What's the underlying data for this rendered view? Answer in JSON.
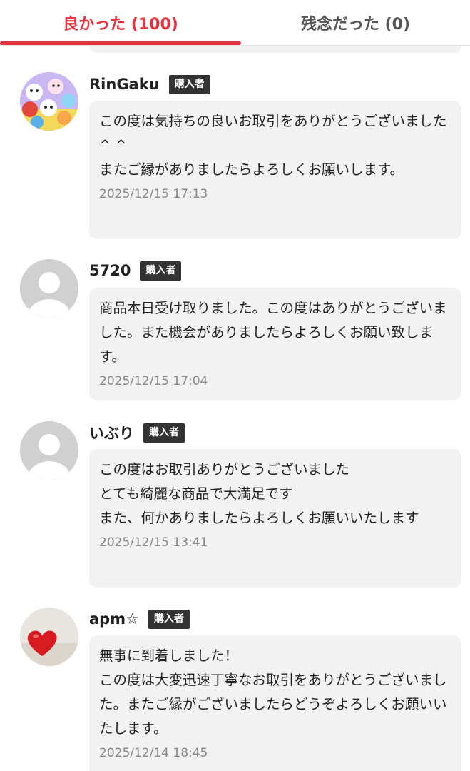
{
  "tabs": {
    "good_label": "良かった (100)",
    "bad_label": "残念だった (0)",
    "active": "good"
  },
  "colors": {
    "accent": "#e3343f",
    "badge_bg": "#333333",
    "bubble_bg": "#f2f2f2"
  },
  "reviews": [
    {
      "name": "RinGaku",
      "badge": "購入者",
      "avatar": "character-collage-avatar",
      "comment": "この度は気持ちの良いお取引をありがとうございました^ ^\nまたご縁がありましたらよろしくお願いします。",
      "date": "2025/12/15 17:13"
    },
    {
      "name": "5720",
      "badge": "購入者",
      "avatar": "default-user-avatar",
      "comment": "商品本日受け取りました。この度はありがとうございました。また機会がありましたらよろしくお願い致します。",
      "date": "2025/12/15 17:04"
    },
    {
      "name": "いぶり",
      "badge": "購入者",
      "avatar": "default-user-avatar",
      "comment": "この度はお取引ありがとうございました\nとても綺麗な商品で大満足です\nまた、何かありましたらよろしくお願いいたします",
      "date": "2025/12/15 13:41"
    },
    {
      "name": "apm☆",
      "badge": "購入者",
      "avatar": "red-heart-avatar",
      "comment": "無事に到着しました！\nこの度は大変迅速丁寧なお取引をありがとうございました。またご縁がございましたらどうぞよろしくお願いいたします。",
      "date": "2025/12/14 18:45"
    }
  ]
}
